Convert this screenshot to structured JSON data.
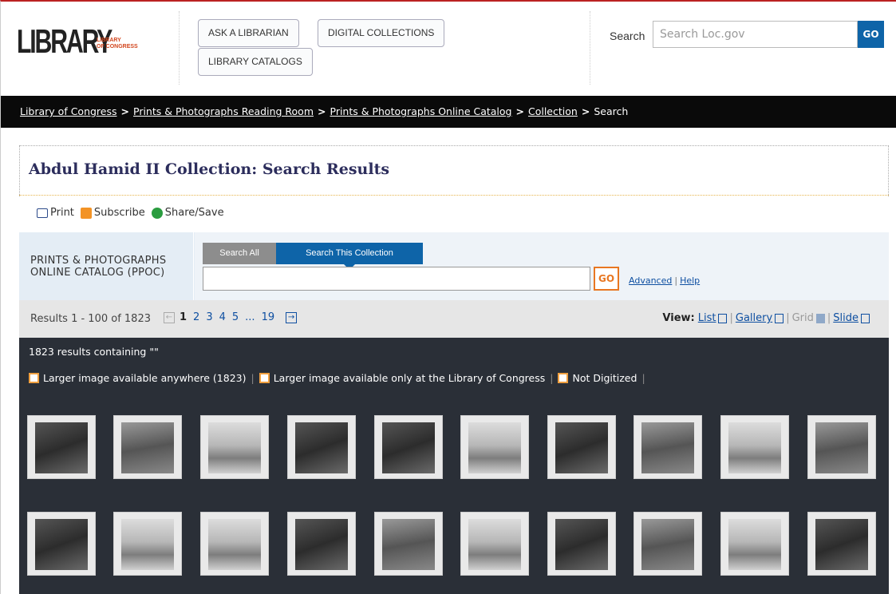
{
  "header": {
    "logo_big": "LIBRARY",
    "logo_small_line1": "LIBRARY",
    "logo_small_line2": "OF CONGRESS",
    "buttons": [
      "ASK A LIBRARIAN",
      "DIGITAL COLLECTIONS",
      "LIBRARY CATALOGS"
    ],
    "search_label": "Search",
    "search_placeholder": "Search Loc.gov",
    "search_go": "GO"
  },
  "breadcrumb": {
    "items": [
      "Library of Congress",
      "Prints & Photographs Reading Room",
      "Prints & Photographs Online Catalog",
      "Collection"
    ],
    "current": "Search",
    "separator": ">"
  },
  "page_title": "Abdul Hamid II Collection: Search Results",
  "tools": {
    "print": "Print",
    "subscribe": "Subscribe",
    "share": "Share/Save"
  },
  "catalog": {
    "name_line1": "PRINTS & PHOTOGRAPHS",
    "name_line2": "ONLINE CATALOG (PPOC)",
    "tab_all": "Search All",
    "tab_this": "Search This Collection",
    "input_value": "",
    "go": "GO",
    "advanced": "Advanced",
    "help": "Help"
  },
  "results": {
    "count_text": "Results 1 - 100 of 1823",
    "pages": [
      "1",
      "2",
      "3",
      "4",
      "5",
      "...",
      "19"
    ],
    "current_page": "1",
    "view_label": "View:",
    "view_list": "List",
    "view_gallery": "Gallery",
    "view_grid": "Grid",
    "view_slide": "Slide"
  },
  "gallery": {
    "info": "1823 results containing \"\"",
    "filter_anywhere": "Larger image available anywhere (1823)",
    "filter_loc": "Larger image available only at the Library of Congress",
    "filter_not_digitized": "Not Digitized"
  },
  "colors": {
    "brand_blue": "#0e64a8",
    "go_orange": "#e87722",
    "dark_panel": "#2a2f37",
    "title_navy": "#2c2d5c"
  }
}
